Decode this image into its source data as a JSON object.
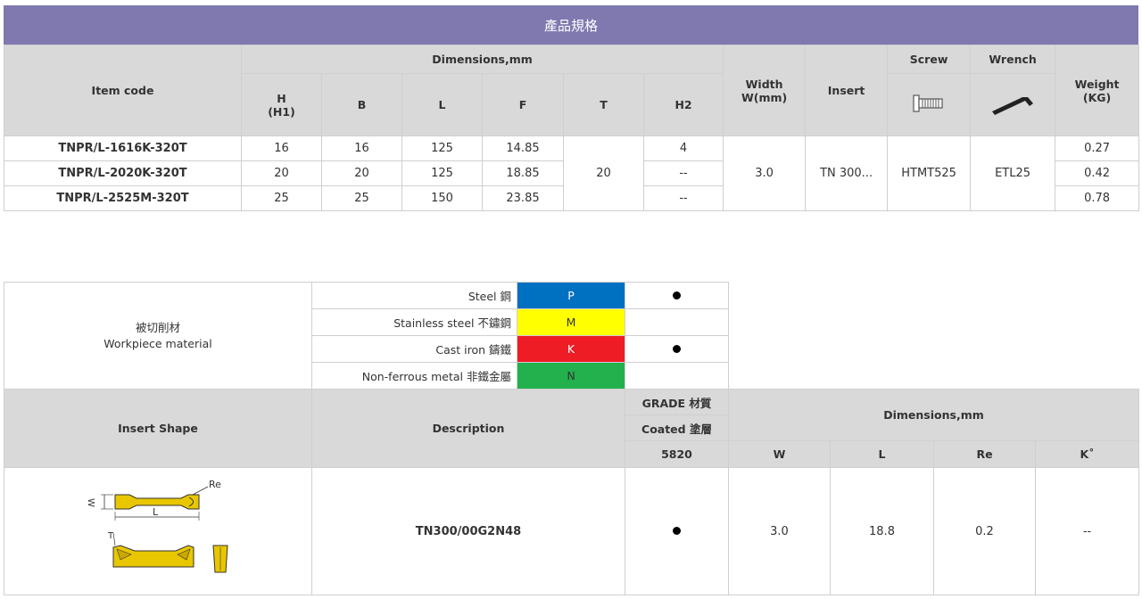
{
  "banner": {
    "title": "產品規格"
  },
  "spec": {
    "headers": {
      "item_code": "Item code",
      "dimensions": "Dimensions,mm",
      "h": "H",
      "h1": "(H1)",
      "b": "B",
      "l": "L",
      "f": "F",
      "t": "T",
      "h2": "H2",
      "width1": "Width",
      "width2": "W(mm)",
      "insert": "Insert",
      "screw": "Screw",
      "wrench": "Wrench",
      "weight1": "Weight",
      "weight2": "(KG)"
    },
    "rows": [
      {
        "code": "TNPR/L-1616K-320T",
        "h": "16",
        "b": "16",
        "l": "125",
        "f": "14.85",
        "h2": "4",
        "weight": "0.27"
      },
      {
        "code": "TNPR/L-2020K-320T",
        "h": "20",
        "b": "20",
        "l": "125",
        "f": "18.85",
        "h2": "--",
        "weight": "0.42"
      },
      {
        "code": "TNPR/L-2525M-320T",
        "h": "25",
        "b": "25",
        "l": "150",
        "f": "23.85",
        "h2": "--",
        "weight": "0.78"
      }
    ],
    "shared": {
      "t": "20",
      "width": "3.0",
      "insert": "TN 300...",
      "screw": "HTMT525",
      "wrench": "ETL25"
    },
    "icons": {
      "screw": "screw-icon",
      "wrench": "hex-wrench-icon"
    }
  },
  "materials": {
    "label_zh": "被切削材",
    "label_en": "Workpiece material",
    "rows": [
      {
        "name": "Steel 鋼",
        "code": "P",
        "color": "#0070c0",
        "mark": true
      },
      {
        "name": "Stainless steel 不鏽鋼",
        "code": "M",
        "color": "#ffff00",
        "mark": false
      },
      {
        "name": "Cast iron 鑄鐵",
        "code": "K",
        "color": "#ee1c25",
        "mark": true
      },
      {
        "name": "Non-ferrous metal 非鐵金屬",
        "code": "N",
        "color": "#22b14c",
        "mark": false
      }
    ]
  },
  "insert": {
    "headers": {
      "shape": "Insert Shape",
      "description": "Description",
      "grade": "GRADE 材質",
      "coated": "Coated 塗層",
      "grade_code": "5820",
      "dimensions": "Dimensions,mm",
      "w": "W",
      "l": "L",
      "re": "Re",
      "k": "K˚"
    },
    "row": {
      "description": "TN300/00G2N48",
      "w": "3.0",
      "l": "18.8",
      "re": "0.2",
      "k": "--"
    },
    "drawing": {
      "label_re": "Re",
      "label_w": "W",
      "label_l": "L",
      "label_t": "T",
      "fill_color": "#e8c700"
    }
  }
}
